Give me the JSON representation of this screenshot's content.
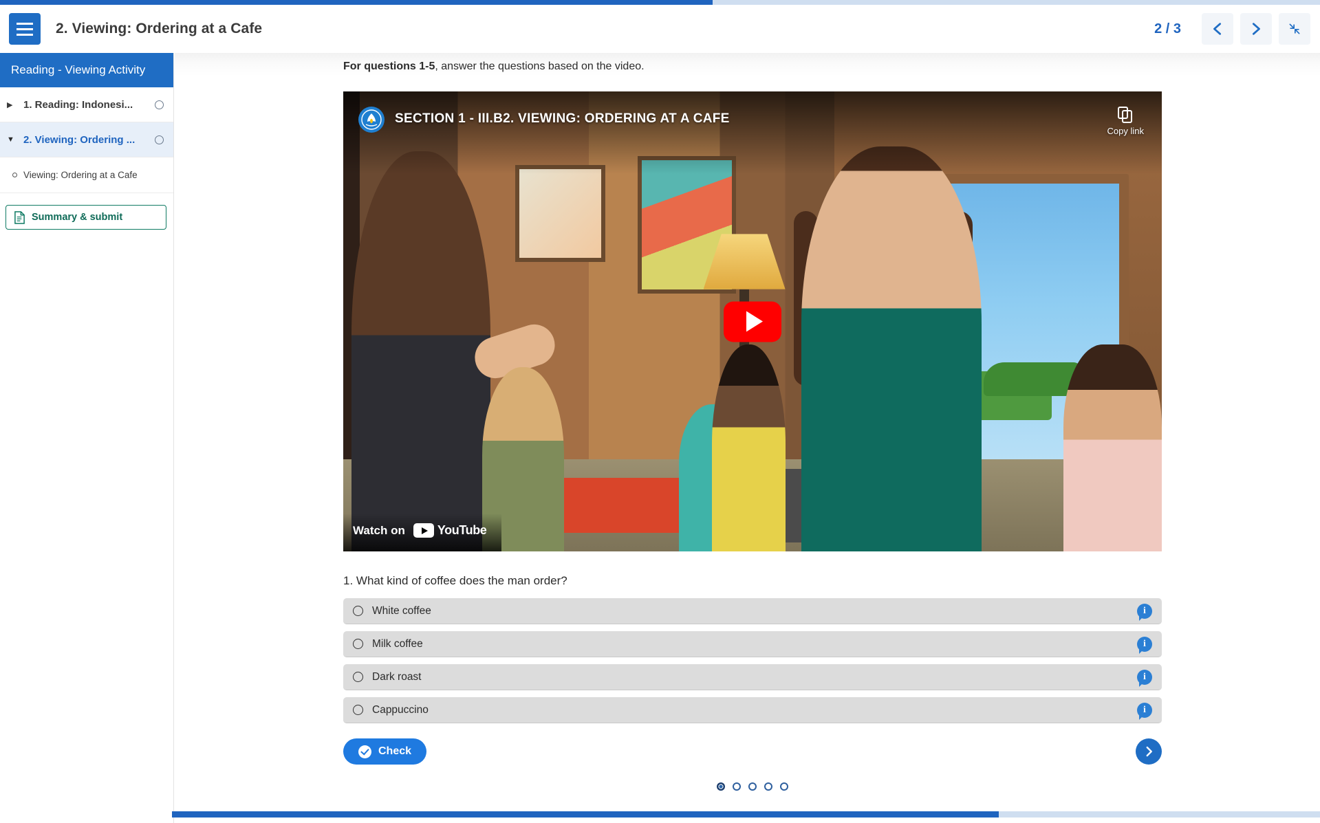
{
  "progress": {
    "top_percent": 54,
    "bottom_percent": 72
  },
  "header": {
    "menu_icon": "hamburger-icon",
    "title": "2. Viewing: Ordering at a Cafe",
    "page_indicator": "2 / 3",
    "prev_label": "Previous",
    "next_label": "Next",
    "fullscreen_label": "Exit fullscreen"
  },
  "sidebar": {
    "title": "Reading - Viewing Activity",
    "items": [
      {
        "label": "1. Reading: Indonesi...",
        "caret": "▶",
        "active": false
      },
      {
        "label": "2. Viewing: Ordering ...",
        "caret": "▼",
        "active": true
      }
    ],
    "sub_item": "Viewing: Ordering at a Cafe",
    "summary_button": "Summary & submit"
  },
  "main": {
    "instructions_bold": "For questions 1-5",
    "instructions_rest": ", answer the questions based on the video.",
    "video": {
      "title": "SECTION 1 - III.B2. VIEWING: ORDERING AT A CAFE",
      "copy_link": "Copy link",
      "watch_on": "Watch on",
      "youtube": "YouTube",
      "play_label": "Play"
    },
    "question": {
      "text": "1. What kind of coffee does the man order?",
      "options": [
        {
          "label": "White coffee",
          "selected": false
        },
        {
          "label": "Milk coffee",
          "selected": false
        },
        {
          "label": "Dark roast",
          "selected": false
        },
        {
          "label": "Cappuccino",
          "selected": false
        }
      ],
      "info_glyph": "i"
    },
    "check_button": "Check",
    "next_button_label": "Next question",
    "dots": [
      {
        "active": true
      },
      {
        "active": false
      },
      {
        "active": false
      },
      {
        "active": false
      },
      {
        "active": false
      }
    ]
  },
  "colors": {
    "accent_blue": "#1f6dc4",
    "progress_blue": "#1f64bf",
    "teal": "#0f7a63",
    "option_gray": "#dcdcdc",
    "youtube_red": "#ff0000"
  }
}
